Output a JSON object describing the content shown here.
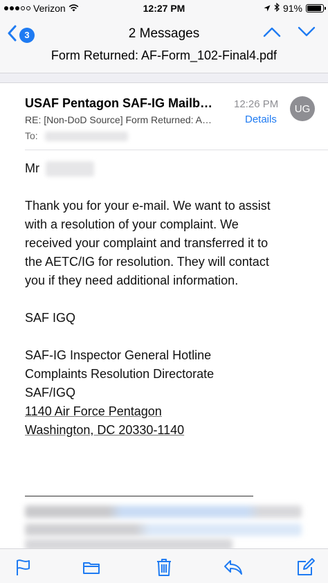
{
  "status_bar": {
    "carrier": "Verizon",
    "time": "12:27 PM",
    "battery": "91%",
    "battery_level": 0.91
  },
  "nav": {
    "back_count": "3",
    "title": "2 Messages",
    "subject": "Form Returned: AF-Form_102-Final4.pdf"
  },
  "message": {
    "sender": "USAF Pentagon SAF-IG Mailb…",
    "time": "12:26 PM",
    "avatar_initials": "UG",
    "subject_line": "RE: [Non-DoD Source] Form Returned: A…",
    "details_label": "Details",
    "to_label": "To:",
    "greeting": "Mr",
    "body_lines": [
      "Thank you for your e-mail.  We want to assist",
      "with a resolution of your complaint.  We",
      "received your complaint and transferred it to",
      "the AETC/IG for resolution.  They will contact",
      "you if they need additional information."
    ],
    "signoff": "SAF IGQ",
    "signature": [
      "SAF-IG Inspector General Hotline",
      "Complaints Resolution Directorate",
      "SAF/IGQ"
    ],
    "address": [
      "1140 Air Force Pentagon",
      "Washington, DC 20330-1140"
    ]
  },
  "colors": {
    "accent": "#1f7bf2",
    "avatar": "#8e8e93",
    "bar_background": "#f7f7f8"
  },
  "icons": {
    "toolbar": [
      "flag-icon",
      "folder-icon",
      "trash-icon",
      "reply-icon",
      "compose-icon"
    ]
  }
}
